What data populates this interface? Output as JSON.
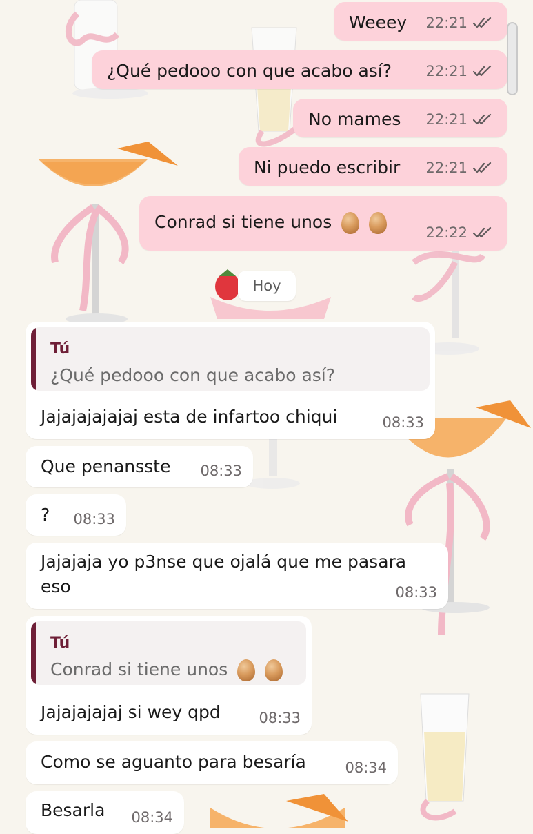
{
  "sent_messages": [
    {
      "text": "Weeey",
      "time": "22:21",
      "emojis": ""
    },
    {
      "text": "¿Qué pedooo con que acabo así?",
      "time": "22:21",
      "emojis": ""
    },
    {
      "text": "No mames",
      "time": "22:21",
      "emojis": ""
    },
    {
      "text": "Ni puedo escribir",
      "time": "22:21",
      "emojis": ""
    },
    {
      "text": "Conrad si tiene unos",
      "time": "22:22",
      "emojis": "egg-emoji egg-emoji"
    }
  ],
  "date_separator": "Hoy",
  "received_messages": [
    {
      "text": "Jajajajajajaj esta de infartoo chiqui",
      "time": "08:33",
      "quote": {
        "author": "Tú",
        "text": "¿Qué pedooo con que acabo así?"
      }
    },
    {
      "text": "Que penansste",
      "time": "08:33"
    },
    {
      "text": "?",
      "time": "08:33"
    },
    {
      "text_line1": "Jajajaja yo p3nse que ojalá que me pasara",
      "text_line2": "eso",
      "time": "08:33"
    },
    {
      "text": "Jajajajajaj si wey qpd",
      "time": "08:33",
      "quote": {
        "author": "Tú",
        "text": "Conrad si tiene unos",
        "emojis": "egg-emoji egg-emoji"
      }
    },
    {
      "text": "Como se aguanto para besaría",
      "time": "08:34"
    },
    {
      "text": "Besarla",
      "time": "08:34"
    }
  ],
  "read_status_icon": "double-check-icon",
  "colors": {
    "sent_bubble": "#fdd2da",
    "received_bubble": "#ffffff",
    "quote_bar": "#6e1f37",
    "wallpaper": "#f8f5ee"
  }
}
